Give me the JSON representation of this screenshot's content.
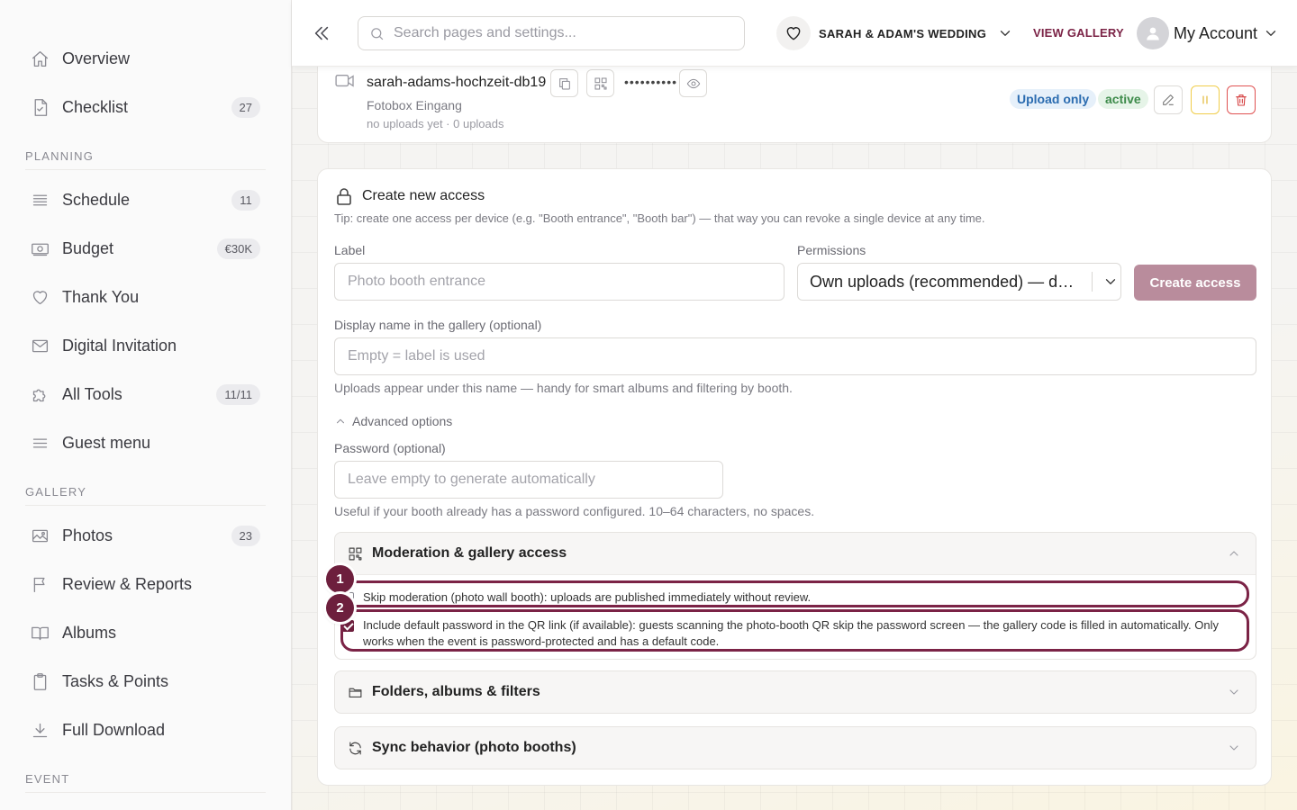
{
  "sidebar": {
    "items_top": [
      {
        "label": "Overview",
        "icon": "home-icon",
        "badge": ""
      },
      {
        "label": "Checklist",
        "icon": "checklist-icon",
        "badge": "27"
      }
    ],
    "planning_title": "PLANNING",
    "planning": [
      {
        "label": "Schedule",
        "icon": "schedule-icon",
        "badge": "11"
      },
      {
        "label": "Budget",
        "icon": "money-icon",
        "badge": "€30K"
      },
      {
        "label": "Thank You",
        "icon": "heart-icon",
        "badge": ""
      },
      {
        "label": "Digital Invitation",
        "icon": "mail-icon",
        "badge": ""
      },
      {
        "label": "All Tools",
        "icon": "puzzle-icon",
        "badge": "11/11"
      },
      {
        "label": "Guest menu",
        "icon": "menu-icon",
        "badge": ""
      }
    ],
    "gallery_title": "GALLERY",
    "gallery": [
      {
        "label": "Photos",
        "icon": "image-icon",
        "badge": "23"
      },
      {
        "label": "Review & Reports",
        "icon": "flag-icon",
        "badge": ""
      },
      {
        "label": "Albums",
        "icon": "book-icon",
        "badge": ""
      },
      {
        "label": "Tasks & Points",
        "icon": "clipboard-icon",
        "badge": ""
      },
      {
        "label": "Full Download",
        "icon": "download-icon",
        "badge": ""
      }
    ],
    "event_title": "EVENT"
  },
  "topbar": {
    "search_placeholder": "Search pages and settings...",
    "event_name": "SARAH & ADAM'S WEDDING",
    "view_gallery": "VIEW GALLERY",
    "account": "My Account"
  },
  "device": {
    "name": "sarah-adams-hochzeit-db19",
    "password_mask": "••••••••••",
    "location": "Fotobox Eingang",
    "status_line": "no uploads yet · 0 uploads",
    "badge_mode": "Upload only",
    "badge_state": "active"
  },
  "form": {
    "title": "Create new access",
    "tip": "Tip: create one access per device (e.g. \"Booth entrance\", \"Booth bar\") — that way you can revoke a single device at any time.",
    "label_label": "Label",
    "label_placeholder": "Photo booth entrance",
    "permissions_label": "Permissions",
    "permissions_value": "Own uploads (recommended) — default",
    "create_button": "Create access",
    "display_label": "Display name in the gallery (optional)",
    "display_placeholder": "Empty = label is used",
    "display_help": "Uploads appear under this name — handy for smart albums and filtering by booth.",
    "advanced": "Advanced options",
    "password_label": "Password (optional)",
    "password_placeholder": "Leave empty to generate automatically",
    "password_help": "Useful if your booth already has a password configured. 10–64 characters, no spaces."
  },
  "moderation": {
    "title": "Moderation & gallery access",
    "option1": "Skip moderation (photo wall booth): uploads are published immediately without review.",
    "option1_checked": false,
    "option2": "Include default password in the QR link (if available): guests scanning the photo-booth QR skip the password screen — the gallery code is filled in automatically. Only works when the event is password-protected and has a default code.",
    "option2_checked": true
  },
  "folders": {
    "title": "Folders, albums & filters"
  },
  "sync": {
    "title": "Sync behavior (photo booths)"
  },
  "markers": [
    "1",
    "2"
  ],
  "colors": {
    "accent": "#7b2346",
    "button_disabled": "#b98c9c",
    "upload_badge": "#2b6cb0",
    "active_badge": "#3d8b4a"
  }
}
